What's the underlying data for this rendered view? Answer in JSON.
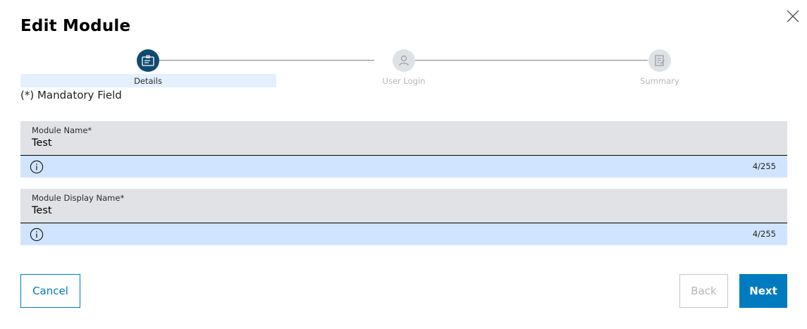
{
  "dialog": {
    "title": "Edit Module"
  },
  "stepper": {
    "steps": [
      {
        "label": "Details",
        "icon": "details-card-icon",
        "state": "active"
      },
      {
        "label": "User Login",
        "icon": "user-icon",
        "state": "inactive"
      },
      {
        "label": "Summary",
        "icon": "summary-document-icon",
        "state": "inactive"
      }
    ]
  },
  "form": {
    "mandatory_note": "(*) Mandatory Field",
    "fields": [
      {
        "label": "Module Name*",
        "value": "Test",
        "counter": "4/255"
      },
      {
        "label": "Module Display Name*",
        "value": "Test",
        "counter": "4/255"
      }
    ]
  },
  "actions": {
    "cancel_label": "Cancel",
    "back_label": "Back",
    "next_label": "Next"
  },
  "colors": {
    "primary": "#007bc0",
    "active_step": "#0f4a70",
    "field_bg": "#e1e2e5",
    "helper_bg": "#d1e4ff"
  }
}
